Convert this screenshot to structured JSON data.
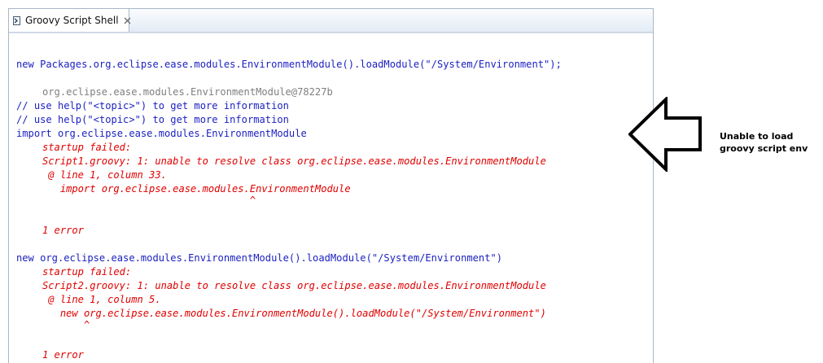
{
  "tab": {
    "title": "Groovy Script Shell",
    "icon": "console-view-icon",
    "close_icon": "close-icon"
  },
  "console": {
    "lines": [
      "new Packages.org.eclipse.ease.modules.EnvironmentModule().loadModule(\"/System/Environment\");",
      "org.eclipse.ease.modules.EnvironmentModule@78227b",
      "// use help(\"<topic>\") to get more information",
      "// use help(\"<topic>\") to get more information",
      "import org.eclipse.ease.modules.EnvironmentModule",
      "startup failed:",
      "Script1.groovy: 1: unable to resolve class org.eclipse.ease.modules.EnvironmentModule",
      " @ line 1, column 33.",
      "   import org.eclipse.ease.modules.EnvironmentModule",
      "                                   ^",
      "1 error",
      "new org.eclipse.ease.modules.EnvironmentModule().loadModule(\"/System/Environment\")",
      "startup failed:",
      "Script2.groovy: 1: unable to resolve class org.eclipse.ease.modules.EnvironmentModule",
      " @ line 1, column 5.",
      "   new org.eclipse.ease.modules.EnvironmentModule().loadModule(\"/System/Environment\")",
      "       ^",
      "1 error"
    ]
  },
  "annotation": {
    "text": "Unable to load groovy script env",
    "icon": "arrow-left-icon"
  },
  "colors": {
    "input": "#1a1fc0",
    "result": "#7f7f7f",
    "error": "#e00000"
  }
}
